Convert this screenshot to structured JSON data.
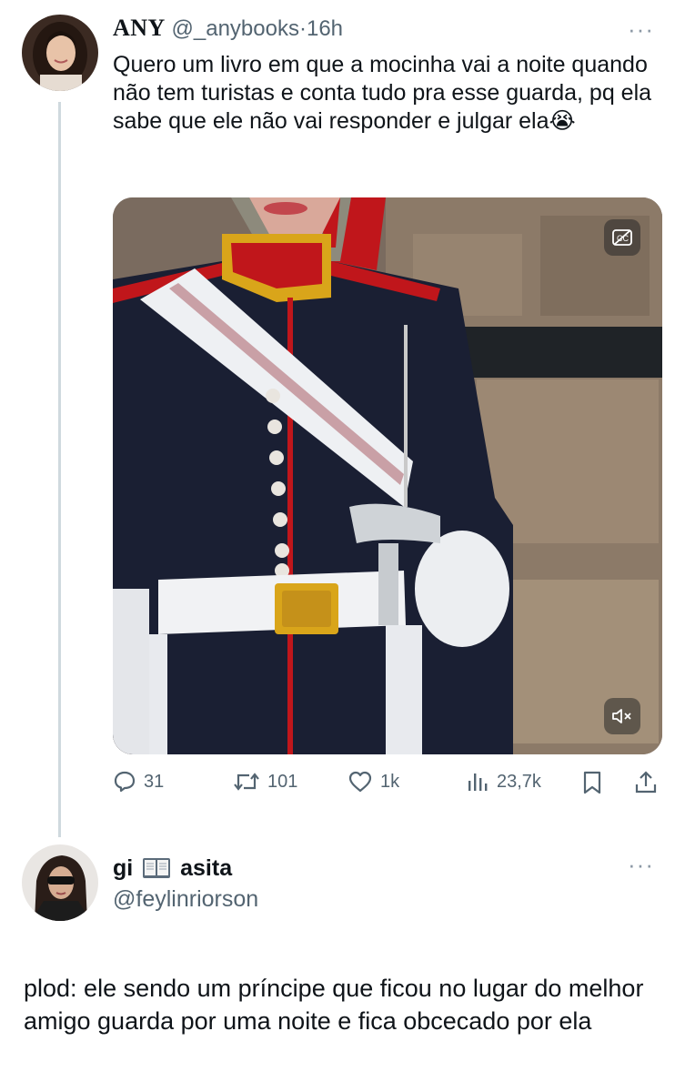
{
  "tweet1": {
    "display_name": "ANY",
    "handle": "@_anybooks",
    "separator": "·",
    "time": "16h",
    "text": "Quero um livro em que a mocinha vai a noite quando não tem turistas e conta tudo pra esse guarda, pq ela sabe que ele não vai responder e julgar ela",
    "emoji": "😭",
    "more_icon": "···",
    "actions": {
      "replies": "31",
      "reposts": "101",
      "likes": "1k",
      "views": "23,7k"
    }
  },
  "tweet2": {
    "display_name_part1": "gi",
    "display_name_part2": "asita",
    "handle": "@feylinriorson",
    "more_icon": "···",
    "text": "plod: ele sendo um príncipe que ficou no lugar do melhor amigo guarda por uma noite e fica obcecado por ela"
  },
  "colors": {
    "text": "#0f1419",
    "secondary": "#536471",
    "thread_line": "#cfd9de",
    "tunic": "#1a1f33",
    "accent_red": "#c0161b",
    "gold": "#d9a51a"
  }
}
